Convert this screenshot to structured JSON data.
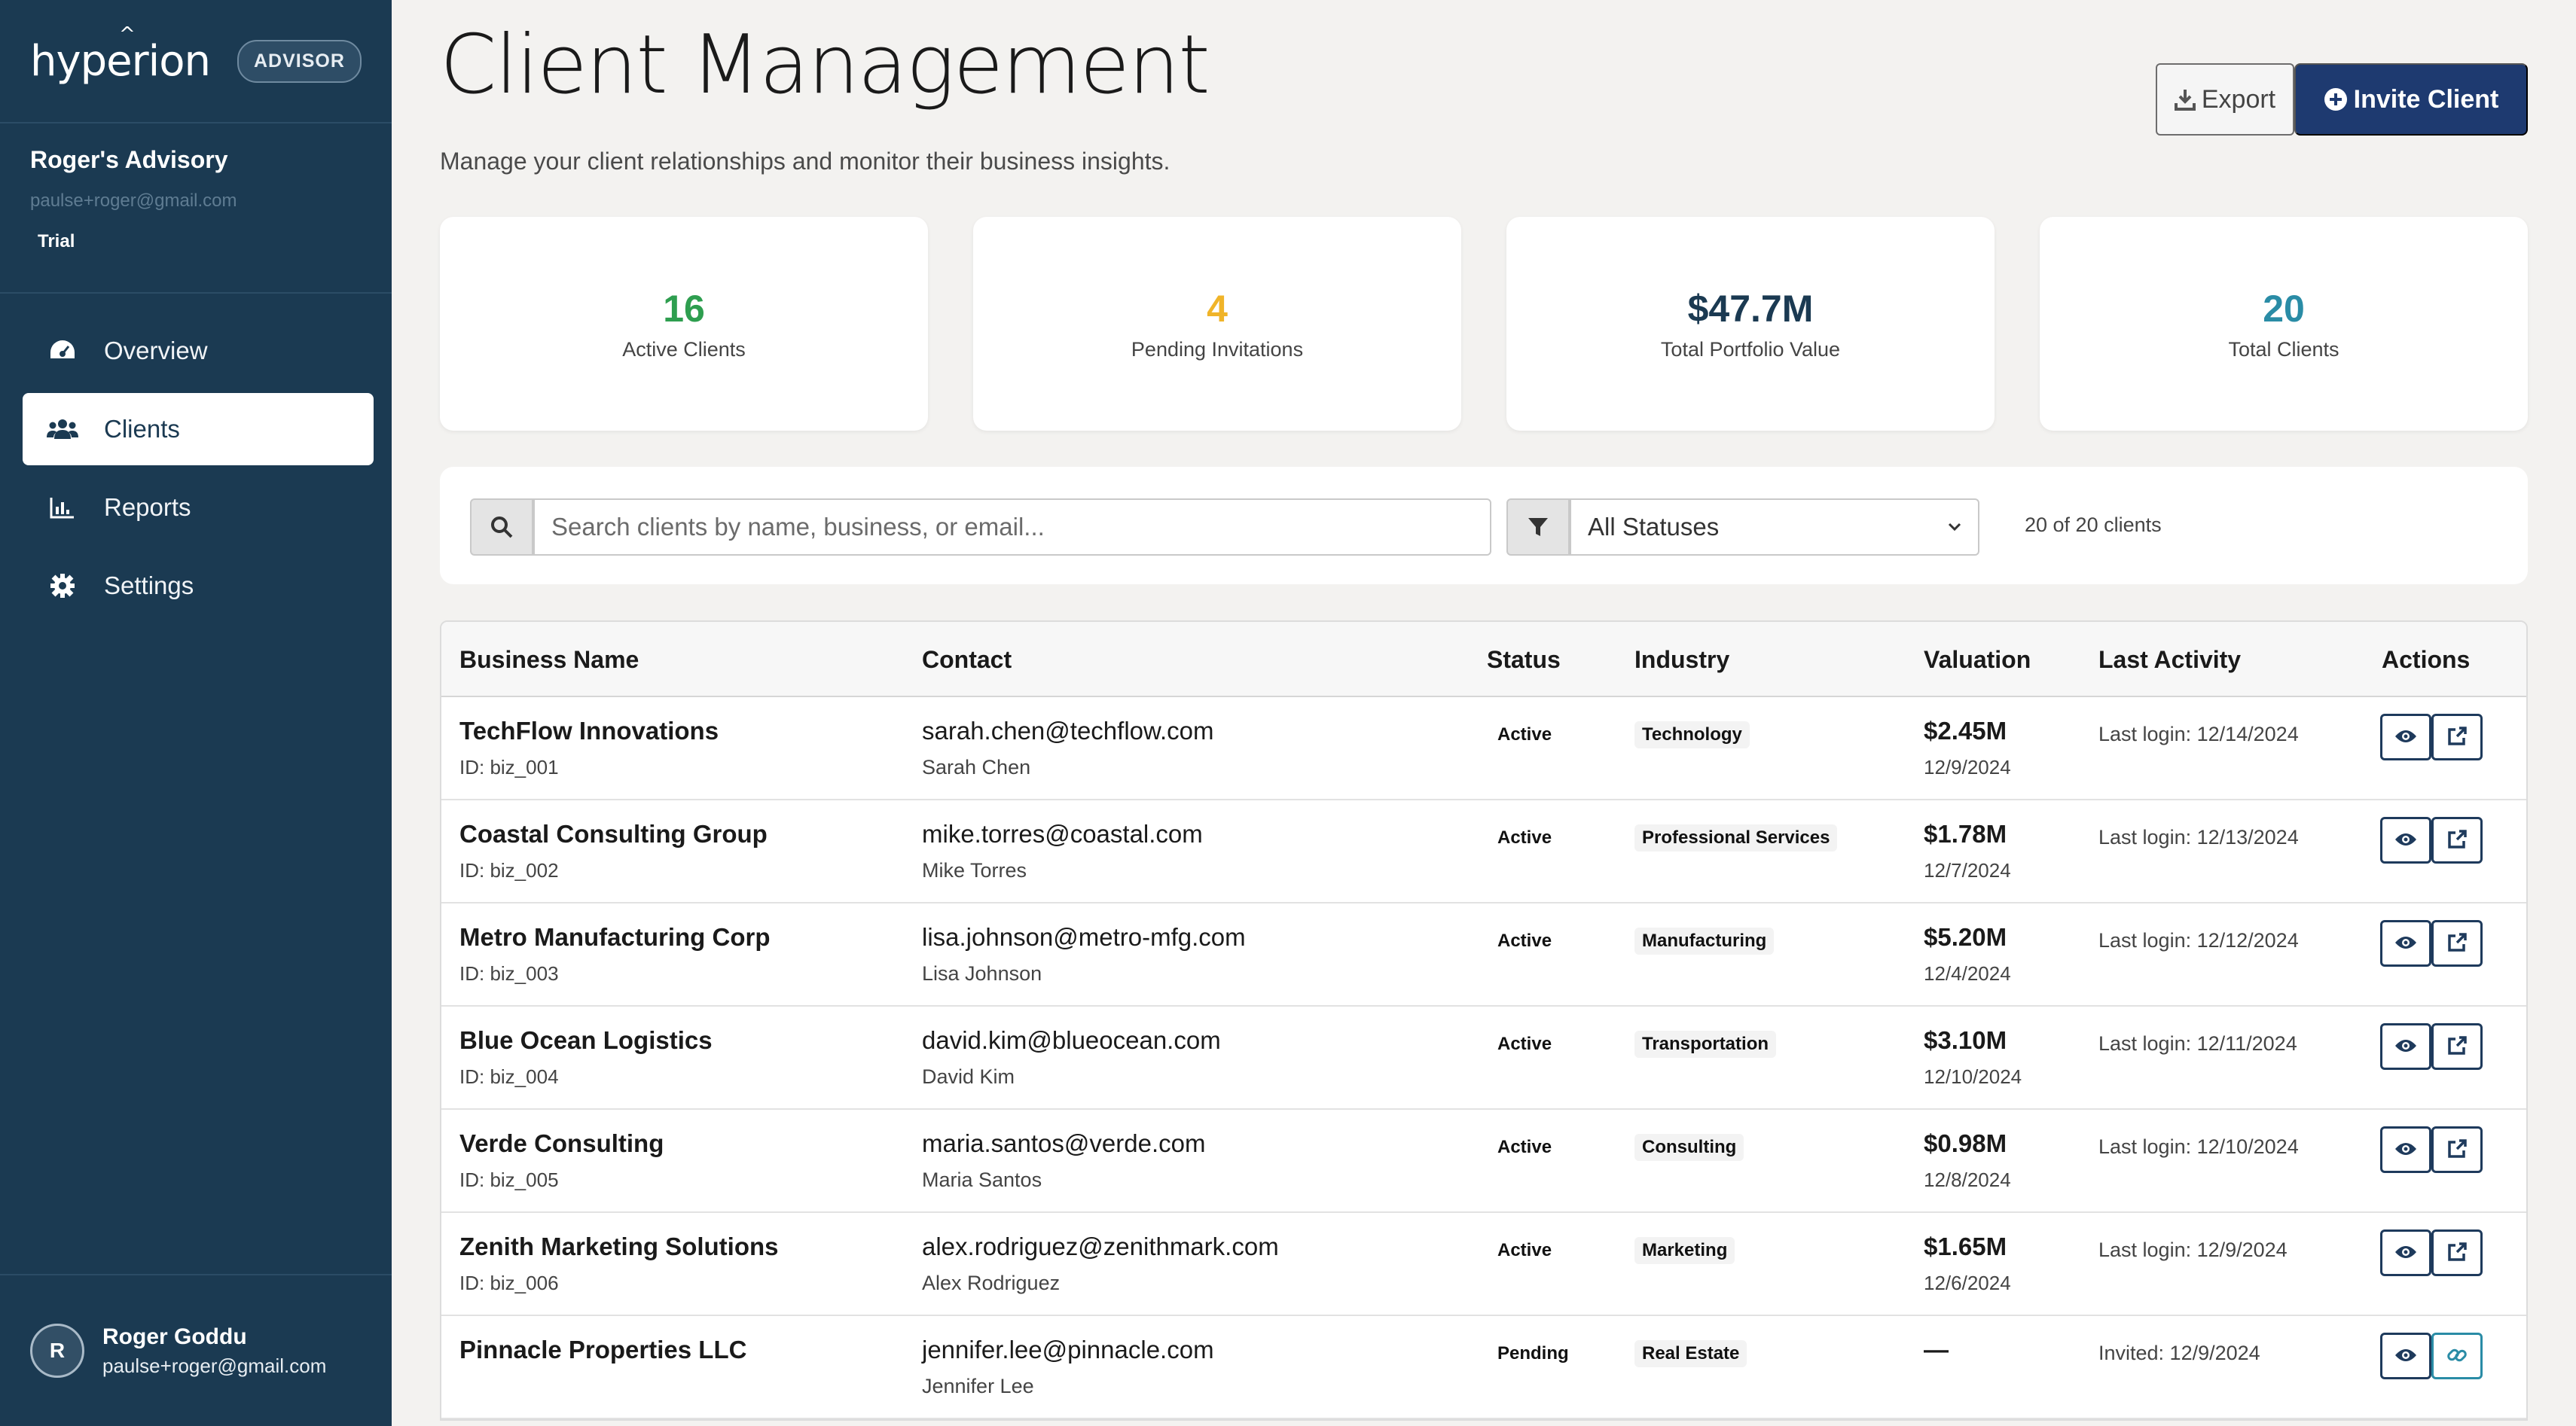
{
  "sidebar": {
    "logo": "hyperion",
    "badge": "ADVISOR",
    "account_name": "Roger's Advisory",
    "account_email": "paulse+roger@gmail.com",
    "plan": "Trial",
    "nav": [
      {
        "label": "Overview",
        "icon": "dashboard-gauge-icon"
      },
      {
        "label": "Clients",
        "icon": "users-icon",
        "active": true
      },
      {
        "label": "Reports",
        "icon": "bar-chart-icon"
      },
      {
        "label": "Settings",
        "icon": "gear-icon"
      }
    ],
    "user": {
      "initial": "R",
      "name": "Roger Goddu",
      "email": "paulse+roger@gmail.com"
    }
  },
  "header": {
    "title": "Client Management",
    "subtitle": "Manage your client relationships and monitor their business insights.",
    "export_label": "Export",
    "invite_label": "Invite Client"
  },
  "stats": [
    {
      "value": "16",
      "label": "Active Clients",
      "color": "#2e9e4f"
    },
    {
      "value": "4",
      "label": "Pending Invitations",
      "color": "#f0b429"
    },
    {
      "value": "$47.7M",
      "label": "Total Portfolio Value",
      "color": "#1b3a52"
    },
    {
      "value": "20",
      "label": "Total Clients",
      "color": "#2a8ca6"
    }
  ],
  "filters": {
    "search_placeholder": "Search clients by name, business, or email...",
    "status_selected": "All Statuses",
    "count_text": "20 of 20 clients"
  },
  "table": {
    "headers": {
      "business": "Business Name",
      "contact": "Contact",
      "status": "Status",
      "industry": "Industry",
      "valuation": "Valuation",
      "activity": "Last Activity",
      "actions": "Actions"
    },
    "rows": [
      {
        "name": "TechFlow Innovations",
        "id": "ID: biz_001",
        "email": "sarah.chen@techflow.com",
        "contact": "Sarah Chen",
        "status": "Active",
        "industry": "Technology",
        "valuation": "$2.45M",
        "val_date": "12/9/2024",
        "activity": "Last login: 12/14/2024",
        "second_action": "external-link-icon"
      },
      {
        "name": "Coastal Consulting Group",
        "id": "ID: biz_002",
        "email": "mike.torres@coastal.com",
        "contact": "Mike Torres",
        "status": "Active",
        "industry": "Professional Services",
        "valuation": "$1.78M",
        "val_date": "12/7/2024",
        "activity": "Last login: 12/13/2024",
        "second_action": "external-link-icon"
      },
      {
        "name": "Metro Manufacturing Corp",
        "id": "ID: biz_003",
        "email": "lisa.johnson@metro-mfg.com",
        "contact": "Lisa Johnson",
        "status": "Active",
        "industry": "Manufacturing",
        "valuation": "$5.20M",
        "val_date": "12/4/2024",
        "activity": "Last login: 12/12/2024",
        "second_action": "external-link-icon"
      },
      {
        "name": "Blue Ocean Logistics",
        "id": "ID: biz_004",
        "email": "david.kim@blueocean.com",
        "contact": "David Kim",
        "status": "Active",
        "industry": "Transportation",
        "valuation": "$3.10M",
        "val_date": "12/10/2024",
        "activity": "Last login: 12/11/2024",
        "second_action": "external-link-icon"
      },
      {
        "name": "Verde Consulting",
        "id": "ID: biz_005",
        "email": "maria.santos@verde.com",
        "contact": "Maria Santos",
        "status": "Active",
        "industry": "Consulting",
        "valuation": "$0.98M",
        "val_date": "12/8/2024",
        "activity": "Last login: 12/10/2024",
        "second_action": "external-link-icon"
      },
      {
        "name": "Zenith Marketing Solutions",
        "id": "ID: biz_006",
        "email": "alex.rodriguez@zenithmark.com",
        "contact": "Alex Rodriguez",
        "status": "Active",
        "industry": "Marketing",
        "valuation": "$1.65M",
        "val_date": "12/6/2024",
        "activity": "Last login: 12/9/2024",
        "second_action": "external-link-icon"
      },
      {
        "name": "Pinnacle Properties LLC",
        "id": "",
        "email": "jennifer.lee@pinnacle.com",
        "contact": "Jennifer Lee",
        "status": "Pending",
        "industry": "Real Estate",
        "valuation": "—",
        "val_date": "",
        "activity": "Invited: 12/9/2024",
        "second_action": "link-icon"
      }
    ]
  }
}
